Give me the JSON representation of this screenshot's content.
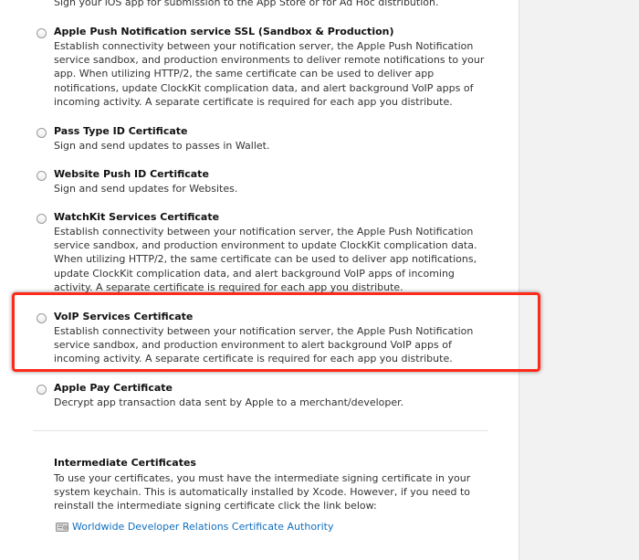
{
  "intro_text": "Sign your iOS app for submission to the App Store or for Ad Hoc distribution.",
  "options": [
    {
      "title": "Apple Push Notification service SSL (Sandbox & Production)",
      "description": "Establish connectivity between your notification server, the Apple Push Notification service sandbox, and production environments to deliver remote notifications to your app. When utilizing HTTP/2, the same certificate can be used to deliver app notifications, update ClockKit complication data, and alert background VoIP apps of incoming activity. A separate certificate is required for each app you distribute.",
      "selected": false
    },
    {
      "title": "Pass Type ID Certificate",
      "description": "Sign and send updates to passes in Wallet.",
      "selected": false
    },
    {
      "title": "Website Push ID Certificate",
      "description": "Sign and send updates for Websites.",
      "selected": false
    },
    {
      "title": "WatchKit Services Certificate",
      "description": "Establish connectivity between your notification server, the Apple Push Notification service sandbox, and production environment to update ClockKit complication data. When utilizing HTTP/2, the same certificate can be used to deliver app notifications, update ClockKit complication data, and alert background VoIP apps of incoming activity. A separate certificate is required for each app you distribute.",
      "selected": false
    },
    {
      "title": "VoIP Services Certificate",
      "description": "Establish connectivity between your notification server, the Apple Push Notification service sandbox, and production environment to alert background VoIP apps of incoming activity. A separate certificate is required for each app you distribute.",
      "selected": false
    },
    {
      "title": "Apple Pay Certificate",
      "description": "Decrypt app transaction data sent by Apple to a merchant/developer.",
      "selected": false
    }
  ],
  "intermediate": {
    "title": "Intermediate Certificates",
    "description": "To use your certificates, you must have the intermediate signing certificate in your system keychain. This is automatically installed by Xcode. However, if you need to reinstall the intermediate signing certificate click the link below:",
    "link_label": "Worldwide Developer Relations Certificate Authority",
    "link_icon": "certificate-icon"
  },
  "colors": {
    "highlight": "#ff2a1a",
    "link": "#0f6fbf",
    "gutter": "#f2f2f2"
  }
}
